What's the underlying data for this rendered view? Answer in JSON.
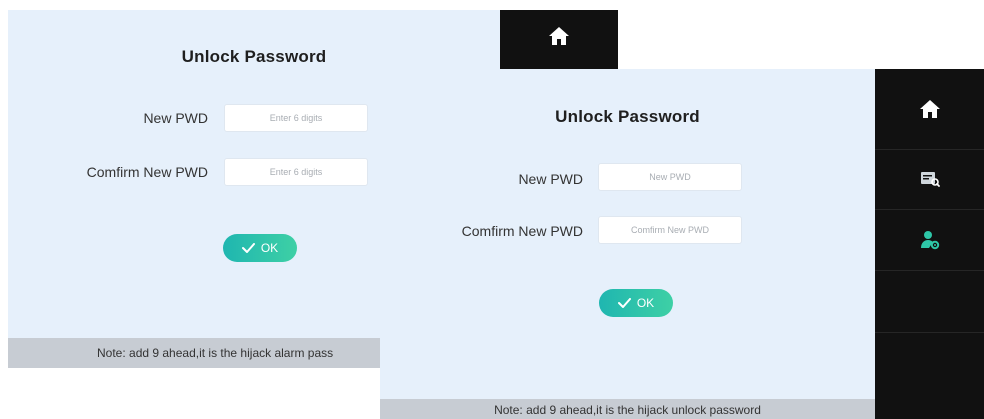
{
  "back_screen": {
    "title": "Unlock Password",
    "new_pwd": {
      "label": "New PWD",
      "placeholder": "Enter 6 digits"
    },
    "confirm_pwd": {
      "label": "Comfirm New PWD",
      "placeholder": "Enter 6 digits"
    },
    "ok_label": "OK",
    "note": "Note:  add 9 ahead,it is the hijack alarm pass"
  },
  "front_screen": {
    "title": "Unlock Password",
    "new_pwd": {
      "label": "New PWD",
      "placeholder": "New PWD"
    },
    "confirm_pwd": {
      "label": "Comfirm New PWD",
      "placeholder": "Comfirm New PWD"
    },
    "ok_label": "OK",
    "note": "Note:  add 9 ahead,it is the hijack unlock password"
  },
  "sidebar": {
    "items": [
      {
        "icon": "home-icon"
      },
      {
        "icon": "record-search-icon"
      },
      {
        "icon": "user-settings-icon"
      }
    ]
  },
  "colors": {
    "panel_bg": "#e6f0fb",
    "sidebar_bg": "#111111",
    "accent": "#2cc2ab",
    "note_bar": "#c7ccd3"
  }
}
